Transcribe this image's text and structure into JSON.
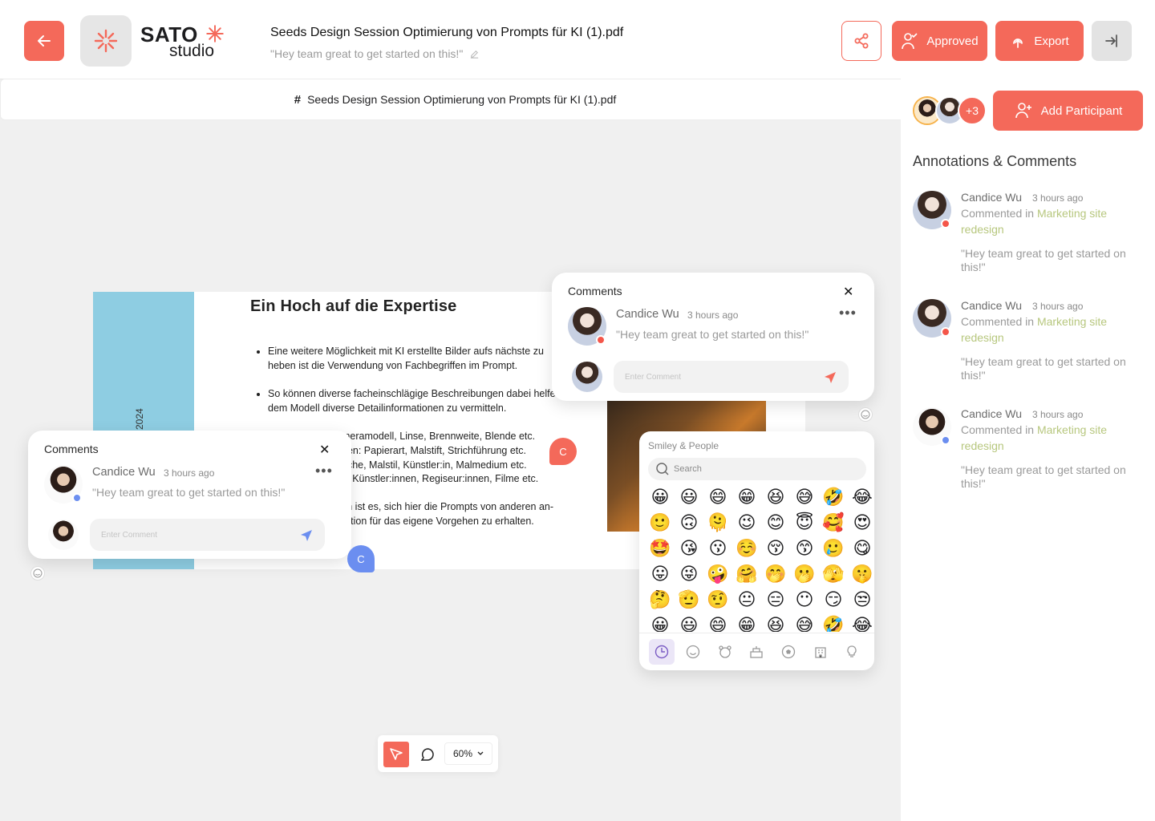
{
  "header": {
    "brand_name": "SATO",
    "brand_sub": "studio",
    "doc_title": "Seeds Design Session Optimierung von Prompts für KI (1).pdf",
    "doc_subtitle": "\"Hey team great to get started on this!\"",
    "approved_label": "Approved",
    "export_label": "Export",
    "accent": "#f4695a"
  },
  "file_bar": {
    "hash": "#",
    "name": "Seeds Design Session Optimierung von Prompts für KI (1).pdf"
  },
  "sidebar": {
    "more_count": "+3",
    "add_participant": "Add Participant",
    "title": "Annotations & Comments",
    "items": [
      {
        "name": "Candice Wu",
        "time": "3 hours ago",
        "prefix": "Commented in ",
        "link": "Marketing site redesign",
        "quote": "\"Hey team great to get started on this!\"",
        "status": "#f4564a"
      },
      {
        "name": "Candice Wu",
        "time": "3 hours ago",
        "prefix": "Commented in ",
        "link": "Marketing site redesign",
        "quote": "\"Hey team great to get started on this!\"",
        "status": "#f4564a"
      },
      {
        "name": "Candice Wu",
        "time": "3 hours ago",
        "prefix": "Commented in ",
        "link": "Marketing site redesign",
        "quote": "\"Hey team great to get started on this!\"",
        "status": "#6b8ef0"
      }
    ]
  },
  "document": {
    "year": "2024",
    "heading": "Ein Hoch auf die Expertise",
    "b1": "Eine weitere Möglichkeit mit KI erstellte Bilder aufs nächste zu heben ist die Verwendung von Fachbegriffen im Prompt.",
    "b2": "So können diverse facheinschlägige Beschreibungen dabei helfen, dem Modell diverse Detailinformationen zu vermitteln.",
    "b3a": "meramodell, Linse, Brennweite, Blende etc.",
    "b3b": "nen: Papierart, Malstift, Strichführung etc.",
    "b3c": "oche, Malstil, Künstler:in, Malmedium etc.",
    "b3d": "s: Künstler:innen, Regiseur:innen, Filme etc.",
    "b4a": "ch ist es, sich hier die Prompts von anderen an-",
    "b4b": "ration für das eigene Vorgehen zu erhalten."
  },
  "comment_top": {
    "title": "Comments",
    "name": "Candice Wu",
    "time": "3 hours ago",
    "quote": "\"Hey team great to get started on this!\"",
    "placeholder": "Enter Comment",
    "marker": "C"
  },
  "comment_left": {
    "title": "Comments",
    "name": "Candice Wu",
    "time": "3 hours ago",
    "quote": "\"Hey team great to get started on this!\"",
    "placeholder": "Enter Comment",
    "marker": "C"
  },
  "emoji_panel": {
    "title": "Smiley & People",
    "search_placeholder": "Search",
    "emojis": [
      "😀",
      "😃",
      "😄",
      "😁",
      "😆",
      "😅",
      "🤣",
      "😂",
      "🙂",
      "🙃",
      "🫠",
      "😉",
      "😊",
      "😇",
      "🥰",
      "😍",
      "🤩",
      "😘",
      "😗",
      "☺️",
      "😚",
      "😙",
      "🥲",
      "😋",
      "😛",
      "😜",
      "🤪",
      "🤗",
      "🤭",
      "🫢",
      "🫣",
      "🤫",
      "🤔",
      "🫡",
      "🤨",
      "😐",
      "😑",
      "😶",
      "😏",
      "😒",
      "😀",
      "😃",
      "😄",
      "😁",
      "😆",
      "😅",
      "🤣",
      "😂"
    ],
    "tabs": [
      "clock-icon",
      "smiley-icon",
      "bear-icon",
      "food-icon",
      "ball-icon",
      "building-icon",
      "bulb-icon"
    ]
  },
  "toolbar": {
    "zoom": "60%"
  }
}
